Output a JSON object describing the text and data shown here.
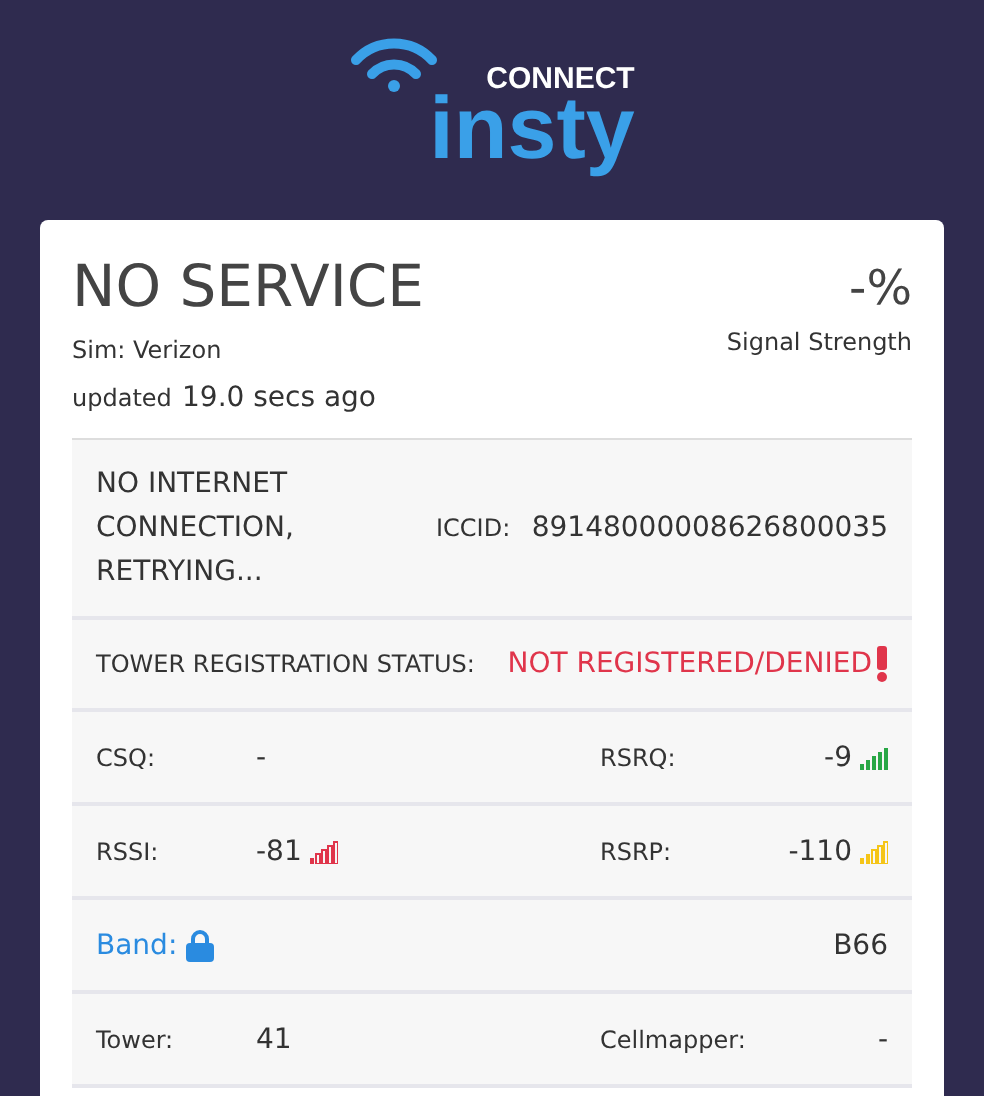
{
  "logo": {
    "top": "CONNECT",
    "bottom": "insty"
  },
  "header": {
    "status": "NO SERVICE",
    "sim": "Sim: Verizon",
    "updated_prefix": "updated",
    "updated_time": "19.0 secs ago",
    "signal_value": "-%",
    "signal_label": "Signal Strength"
  },
  "rows": [
    {
      "kind": "status",
      "message": "NO INTERNET CONNECTION, RETRYING...",
      "label": "ICCID:",
      "value": "89148000008626800035"
    },
    {
      "kind": "registration",
      "label": "TOWER REGISTRATION STATUS:",
      "value": "NOT REGISTERED/DENIED",
      "alert": true
    },
    {
      "kind": "pair",
      "cells": [
        {
          "label": "CSQ:",
          "value": "-"
        },
        {
          "label": "RSRQ:",
          "value": "-9",
          "level": 1,
          "color": "#28a745"
        }
      ]
    },
    {
      "kind": "pair",
      "cells": [
        {
          "label": "RSSI:",
          "value": "-81",
          "level": 0.2,
          "color": "#e0354b"
        },
        {
          "label": "RSRP:",
          "value": "-110",
          "level": 0.4,
          "color": "#f5c518"
        }
      ]
    },
    {
      "kind": "band",
      "label": "Band:",
      "locked": true,
      "value": "B66"
    },
    {
      "kind": "pair",
      "cells": [
        {
          "label": "Tower:",
          "value": "41"
        },
        {
          "label": "Cellmapper:",
          "value": "-"
        }
      ]
    }
  ]
}
